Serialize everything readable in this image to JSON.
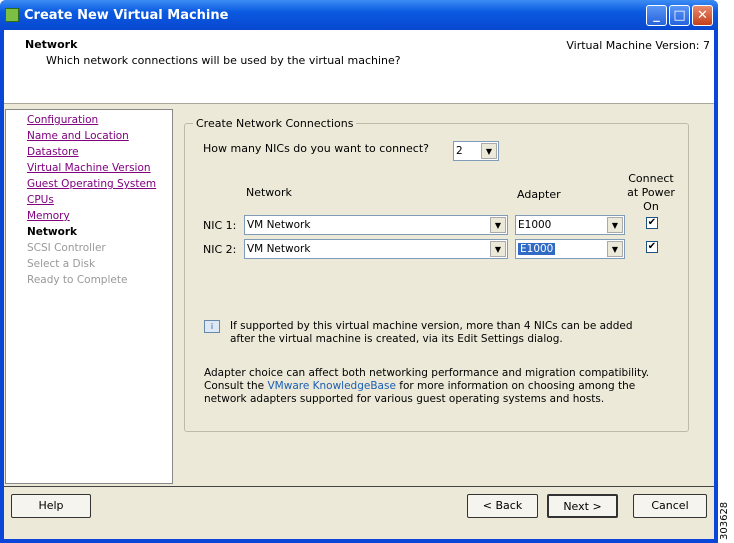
{
  "window": {
    "title": "Create New Virtual Machine"
  },
  "header": {
    "title": "Network",
    "subtitle": "Which network connections will be used by the virtual machine?",
    "version": "Virtual Machine Version: 7"
  },
  "steps": [
    {
      "label": "Configuration",
      "state": "link"
    },
    {
      "label": "Name and Location",
      "state": "link"
    },
    {
      "label": "Datastore",
      "state": "link"
    },
    {
      "label": "Virtual Machine Version",
      "state": "link"
    },
    {
      "label": "Guest Operating System",
      "state": "link"
    },
    {
      "label": "CPUs",
      "state": "link"
    },
    {
      "label": "Memory",
      "state": "link"
    },
    {
      "label": "Network",
      "state": "current"
    },
    {
      "label": "SCSI Controller",
      "state": "disabled"
    },
    {
      "label": "Select a Disk",
      "state": "disabled"
    },
    {
      "label": "Ready to Complete",
      "state": "disabled"
    }
  ],
  "group": {
    "label": "Create Network Connections",
    "nic_count_question": "How many NICs do you want to connect?",
    "nic_count": "2",
    "col_network": "Network",
    "col_adapter": "Adapter",
    "col_connect": "Connect at Power On",
    "nics": [
      {
        "label": "NIC 1:",
        "network": "VM Network",
        "adapter": "E1000",
        "connect": true
      },
      {
        "label": "NIC 2:",
        "network": "VM Network",
        "adapter": "E1000",
        "connect": true
      }
    ],
    "info": "If supported by this virtual machine version, more than 4 NICs can be added after the virtual machine is created, via its Edit Settings dialog.",
    "note_pre": "Adapter choice can affect both networking performance and migration compatibility. Consult the ",
    "note_link": "VMware KnowledgeBase",
    "note_post": " for more information on choosing among the network adapters supported for various guest operating systems and hosts."
  },
  "buttons": {
    "help": "Help",
    "back": "< Back",
    "next": "Next >",
    "cancel": "Cancel"
  },
  "figure_id": "303628"
}
